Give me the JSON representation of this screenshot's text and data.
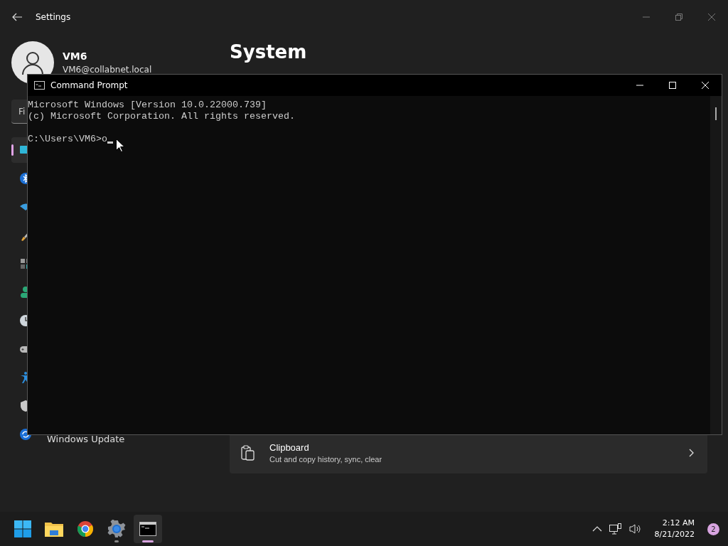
{
  "settings": {
    "title": "Settings",
    "user": {
      "name": "VM6",
      "email": "VM6@collabnet.local"
    },
    "search": {
      "placeholder": "Fi"
    },
    "page_title": "System",
    "sidebar": {
      "items": [
        {
          "selected": true
        },
        {
          "selected": false
        },
        {
          "selected": false
        },
        {
          "selected": false
        },
        {
          "selected": false
        },
        {
          "selected": false
        },
        {
          "selected": false
        },
        {
          "selected": false
        },
        {
          "selected": false
        },
        {
          "selected": false
        },
        {
          "label": "Windows Update",
          "selected": false
        }
      ]
    },
    "cards": [
      {
        "title": "Clipboard",
        "subtitle": "Cut and copy history, sync, clear"
      }
    ]
  },
  "command_prompt": {
    "title": "Command Prompt",
    "lines": [
      "Microsoft Windows [Version 10.0.22000.739]",
      "(c) Microsoft Corporation. All rights reserved."
    ],
    "prompt": "C:\\Users\\VM6>o"
  },
  "taskbar": {
    "apps": [
      {
        "kind": "start",
        "running": false,
        "active": false
      },
      {
        "kind": "explorer",
        "running": false,
        "active": false
      },
      {
        "kind": "chrome",
        "running": false,
        "active": false
      },
      {
        "kind": "settings",
        "running": true,
        "active": false
      },
      {
        "kind": "terminal",
        "running": true,
        "active": true
      }
    ],
    "time": "2:12 AM",
    "date": "8/21/2022",
    "notifications": "2"
  }
}
